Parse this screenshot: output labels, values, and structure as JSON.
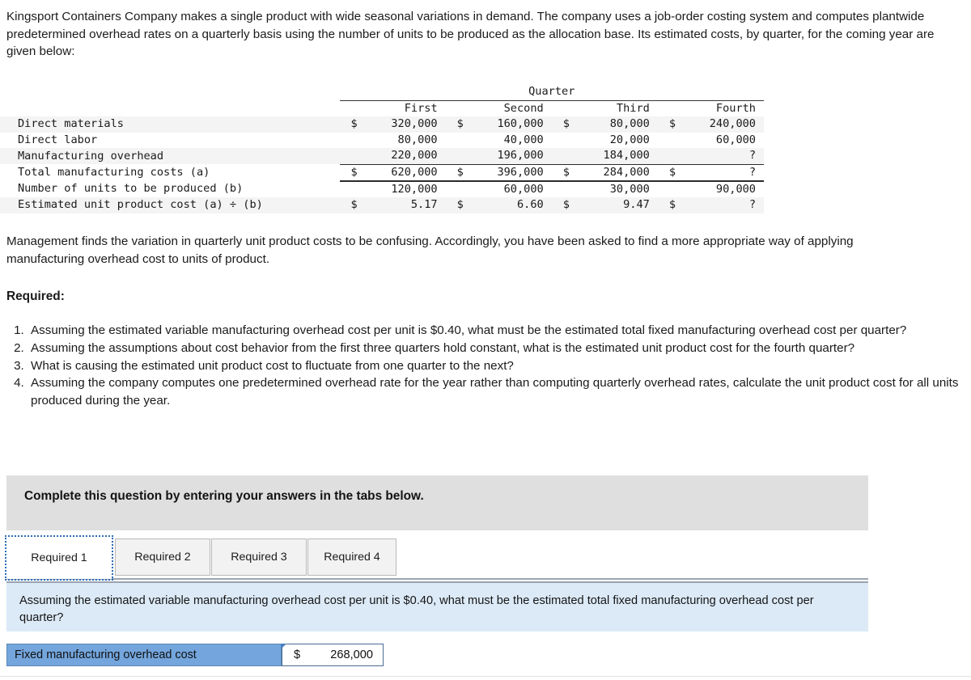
{
  "intro": {
    "paragraph": "Kingsport Containers Company makes a single product with wide seasonal variations in demand. The company uses a job-order costing system and computes plantwide predetermined overhead rates on a quarterly basis using the number of units to be produced as the allocation base. Its estimated costs, by quarter, for the coming year are given below:"
  },
  "cost_table": {
    "group_header": "Quarter",
    "columns": [
      "First",
      "Second",
      "Third",
      "Fourth"
    ],
    "rows": [
      {
        "label": "Direct materials",
        "cells": [
          {
            "dollar": "$",
            "amount": "320,000"
          },
          {
            "dollar": "$",
            "amount": "160,000"
          },
          {
            "dollar": "$",
            "amount": "80,000"
          },
          {
            "dollar": "$",
            "amount": "240,000"
          }
        ]
      },
      {
        "label": "Direct labor",
        "cells": [
          {
            "dollar": "",
            "amount": "80,000"
          },
          {
            "dollar": "",
            "amount": "40,000"
          },
          {
            "dollar": "",
            "amount": "20,000"
          },
          {
            "dollar": "",
            "amount": "60,000"
          }
        ]
      },
      {
        "label": "Manufacturing overhead",
        "cells": [
          {
            "dollar": "",
            "amount": "220,000"
          },
          {
            "dollar": "",
            "amount": "196,000"
          },
          {
            "dollar": "",
            "amount": "184,000"
          },
          {
            "dollar": "",
            "amount": "?"
          }
        ]
      },
      {
        "label": "Total manufacturing costs (a)",
        "cells": [
          {
            "dollar": "$",
            "amount": "620,000"
          },
          {
            "dollar": "$",
            "amount": "396,000"
          },
          {
            "dollar": "$",
            "amount": "284,000"
          },
          {
            "dollar": "$",
            "amount": "?"
          }
        ]
      },
      {
        "label": "Number of units to be produced (b)",
        "cells": [
          {
            "dollar": "",
            "amount": "120,000"
          },
          {
            "dollar": "",
            "amount": "60,000"
          },
          {
            "dollar": "",
            "amount": "30,000"
          },
          {
            "dollar": "",
            "amount": "90,000"
          }
        ]
      },
      {
        "label": "Estimated unit product cost (a) ÷ (b)",
        "cells": [
          {
            "dollar": "$",
            "amount": "5.17"
          },
          {
            "dollar": "$",
            "amount": "6.60"
          },
          {
            "dollar": "$",
            "amount": "9.47"
          },
          {
            "dollar": "$",
            "amount": "?"
          }
        ]
      }
    ]
  },
  "mid_paragraph": "Management finds the variation in quarterly unit product costs to be confusing. Accordingly, you have been asked to find a more appropriate way of applying manufacturing overhead cost to units of product.",
  "required_heading": "Required:",
  "required_items": [
    "Assuming the estimated variable manufacturing overhead cost per unit is $0.40, what must be the estimated total fixed manufacturing overhead cost per quarter?",
    "Assuming the assumptions about cost behavior from the first three quarters hold constant, what is the estimated unit product cost for the fourth quarter?",
    "What is causing the estimated unit product cost to fluctuate from one quarter to the next?",
    "Assuming the company computes one predetermined overhead rate for the year rather than computing quarterly overhead rates, calculate the unit product cost for all units produced during the year."
  ],
  "instruction_banner": "Complete this question by entering your answers in the tabs below.",
  "tabs": [
    {
      "label": "Required 1",
      "active": true
    },
    {
      "label": "Required 2",
      "active": false
    },
    {
      "label": "Required 3",
      "active": false
    },
    {
      "label": "Required 4",
      "active": false
    }
  ],
  "question_panel": {
    "text": "Assuming the estimated variable manufacturing overhead cost per unit is $0.40, what must be the estimated total fixed manufacturing overhead cost per quarter?"
  },
  "answer_row": {
    "label": "Fixed manufacturing overhead cost",
    "currency": "$",
    "value": "268,000"
  },
  "colors": {
    "table_header_bg": "#d4dae5",
    "stripe_bg": "#f4f4f4",
    "banner_gray": "#dfdfdf",
    "panel_blue": "#dceaf7",
    "answer_label_blue": "#74a6dd",
    "tab_focus_blue": "#2b6cb8"
  }
}
